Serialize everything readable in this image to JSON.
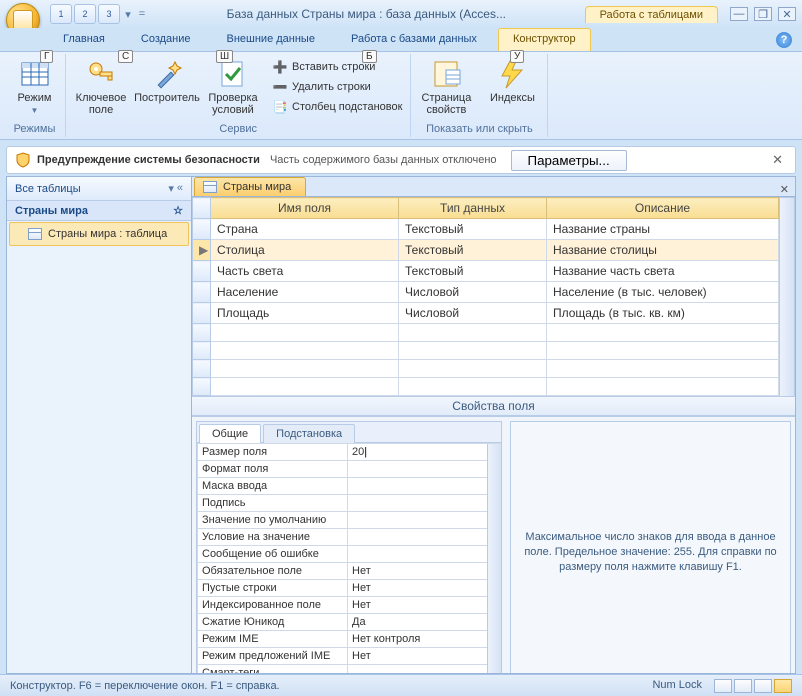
{
  "title": "База данных Страны мира : база данных (Acces...",
  "context_tab": "Работа с таблицами",
  "qat_labels": [
    "1",
    "2",
    "3"
  ],
  "tabs": {
    "home": "Главная",
    "create": "Создание",
    "external": "Внешние данные",
    "dbtools": "Работа с базами данных",
    "design": "Конструктор"
  },
  "key_hints": {
    "g": "Г",
    "s": "С",
    "sh": "Ш",
    "b": "Б",
    "u": "У"
  },
  "ribbon": {
    "mode": "Режим",
    "modes_group": "Режимы",
    "key_field": "Ключевое поле",
    "builder": "Построитель",
    "validate": "Проверка условий",
    "insert_rows": "Вставить строки",
    "delete_rows": "Удалить строки",
    "lookup_col": "Столбец подстановок",
    "tools_group": "Сервис",
    "prop_sheet": "Страница свойств",
    "indexes": "Индексы",
    "showhide_group": "Показать или скрыть"
  },
  "security": {
    "title": "Предупреждение системы безопасности",
    "text": "Часть содержимого базы данных отключено",
    "button": "Параметры..."
  },
  "nav": {
    "all_tables": "Все таблицы",
    "group": "Страны мира",
    "item": "Страны мира : таблица"
  },
  "doc_tab": "Страны мира",
  "cols": {
    "field": "Имя поля",
    "type": "Тип данных",
    "desc": "Описание"
  },
  "rows": [
    {
      "name": "Страна",
      "type": "Текстовый",
      "desc": "Название страны"
    },
    {
      "name": "Столица",
      "type": "Текстовый",
      "desc": "Название столицы"
    },
    {
      "name": "Часть света",
      "type": "Текстовый",
      "desc": "Название часть света"
    },
    {
      "name": "Население",
      "type": "Числовой",
      "desc": "Население (в тыс. человек)"
    },
    {
      "name": "Площадь",
      "type": "Числовой",
      "desc": "Площадь (в тыс. кв. км)"
    }
  ],
  "props_label": "Свойства поля",
  "prop_tabs": {
    "general": "Общие",
    "lookup": "Подстановка"
  },
  "props": [
    {
      "n": "Размер поля",
      "v": "20"
    },
    {
      "n": "Формат поля",
      "v": ""
    },
    {
      "n": "Маска ввода",
      "v": ""
    },
    {
      "n": "Подпись",
      "v": ""
    },
    {
      "n": "Значение по умолчанию",
      "v": ""
    },
    {
      "n": "Условие на значение",
      "v": ""
    },
    {
      "n": "Сообщение об ошибке",
      "v": ""
    },
    {
      "n": "Обязательное поле",
      "v": "Нет"
    },
    {
      "n": "Пустые строки",
      "v": "Нет"
    },
    {
      "n": "Индексированное поле",
      "v": "Нет"
    },
    {
      "n": "Сжатие Юникод",
      "v": "Да"
    },
    {
      "n": "Режим IME",
      "v": "Нет контроля"
    },
    {
      "n": "Режим предложений IME",
      "v": "Нет"
    },
    {
      "n": "Смарт-теги",
      "v": ""
    }
  ],
  "hint": "Максимальное число знаков для ввода в данное поле.  Предельное значение: 255.  Для справки по размеру поля нажмите клавишу F1.",
  "status": "Конструктор.  F6 = переключение окон.  F1 = справка.",
  "numlock": "Num Lock"
}
